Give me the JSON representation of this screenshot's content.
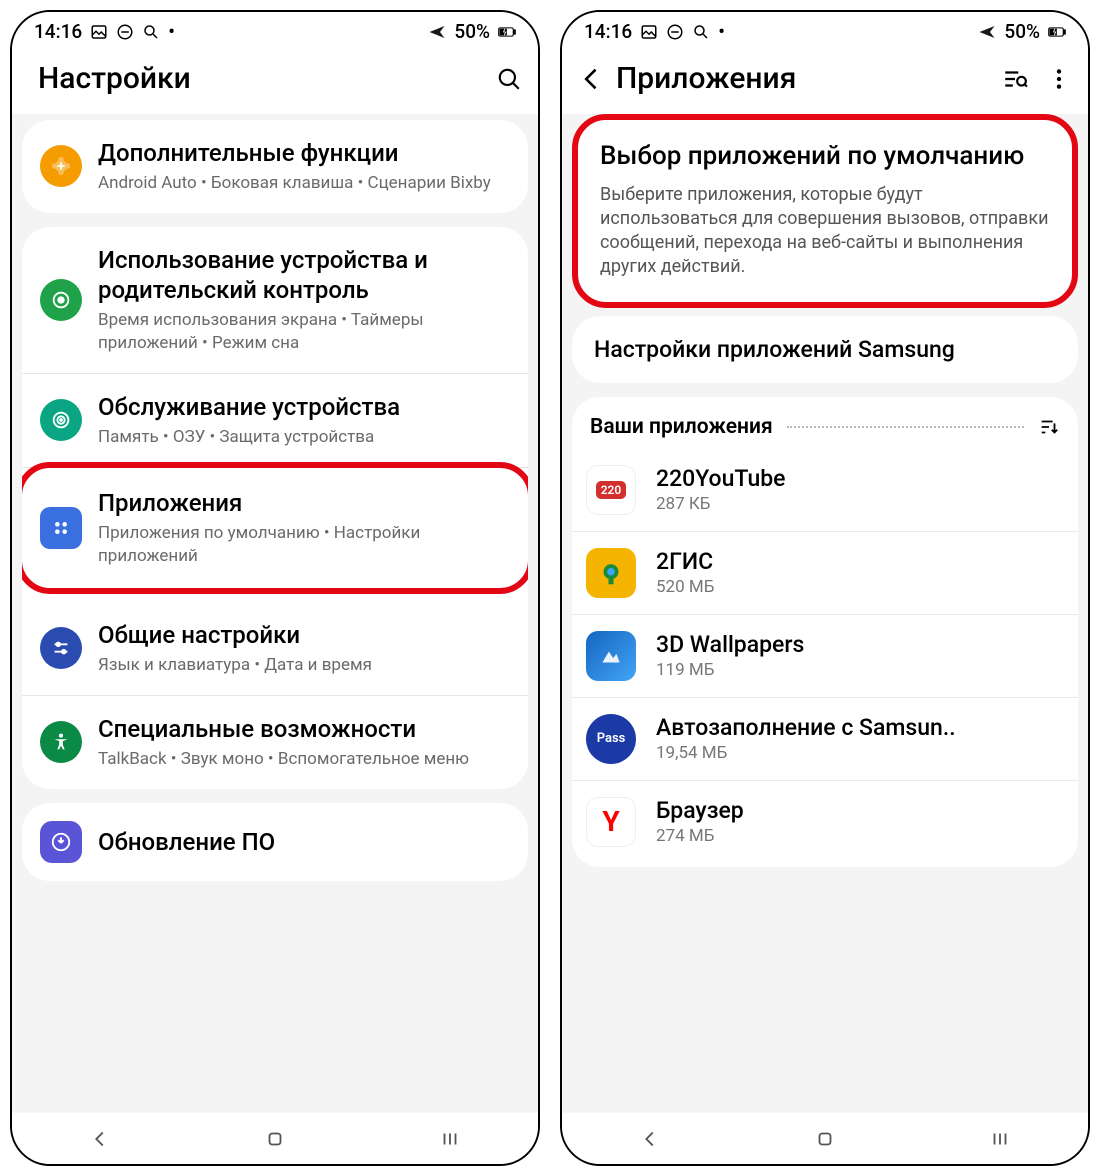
{
  "status": {
    "time": "14:16",
    "battery": "50%"
  },
  "left": {
    "header_title": "Настройки",
    "groups": [
      {
        "rows": [
          {
            "icon": "plus",
            "color": "#f59c00",
            "title": "Дополнительные функции",
            "sub": "Android Auto  •  Боковая клавиша  •  Сценарии Bixby"
          }
        ]
      },
      {
        "rows": [
          {
            "icon": "shield",
            "color": "#1fa24a",
            "title": "Использование устройства и родительский контроль",
            "sub": "Время использования экрана  •  Таймеры приложений  •  Режим сна"
          },
          {
            "icon": "target",
            "color": "#0aa582",
            "title": "Обслуживание устройства",
            "sub": "Память  •  ОЗУ  •  Защита устройства"
          },
          {
            "icon": "dots4",
            "color": "#3a6fe0",
            "title": "Приложения",
            "sub": "Приложения по умолчанию  •  Настройки приложений",
            "highlight": true
          },
          {
            "icon": "sliders",
            "color": "#2a4bb0",
            "title": "Общие настройки",
            "sub": "Язык и клавиатура  •  Дата и время"
          },
          {
            "icon": "person",
            "color": "#0b8a45",
            "title": "Специальные возможности",
            "sub": "TalkBack  •  Звук моно  •  Вспомогательное меню"
          }
        ]
      },
      {
        "rows": [
          {
            "icon": "download",
            "color": "#5a55d6",
            "title": "Обновление ПО",
            "sub": ""
          }
        ]
      }
    ]
  },
  "right": {
    "header_title": "Приложения",
    "default_title": "Выбор приложений по умолчанию",
    "default_sub": "Выберите приложения, которые будут использоваться для совершения вызовов, отправки сообщений, перехода на веб-сайты и выполнения других действий.",
    "samsung_row": "Настройки приложений Samsung",
    "section_title": "Ваши приложения",
    "apps": [
      {
        "name": "220YouTube",
        "size": "287 КБ",
        "badge": "220",
        "bg": "#fff",
        "fg": "#d32f2f"
      },
      {
        "name": "2ГИС",
        "size": "520 МБ",
        "icon": "2gis",
        "bg": "#f5b400"
      },
      {
        "name": "3D Wallpapers",
        "size": "119 МБ",
        "icon": "wall",
        "bg": "#1565c0"
      },
      {
        "name": "Автозаполнение с Samsun..",
        "size": "19,54 МБ",
        "icon": "pass",
        "bg": "#1b3aa5",
        "label": "Pass"
      },
      {
        "name": "Браузер",
        "size": "274 МБ",
        "icon": "yandex",
        "bg": "#fff",
        "fg": "#ff0000",
        "label": "Y"
      }
    ]
  }
}
